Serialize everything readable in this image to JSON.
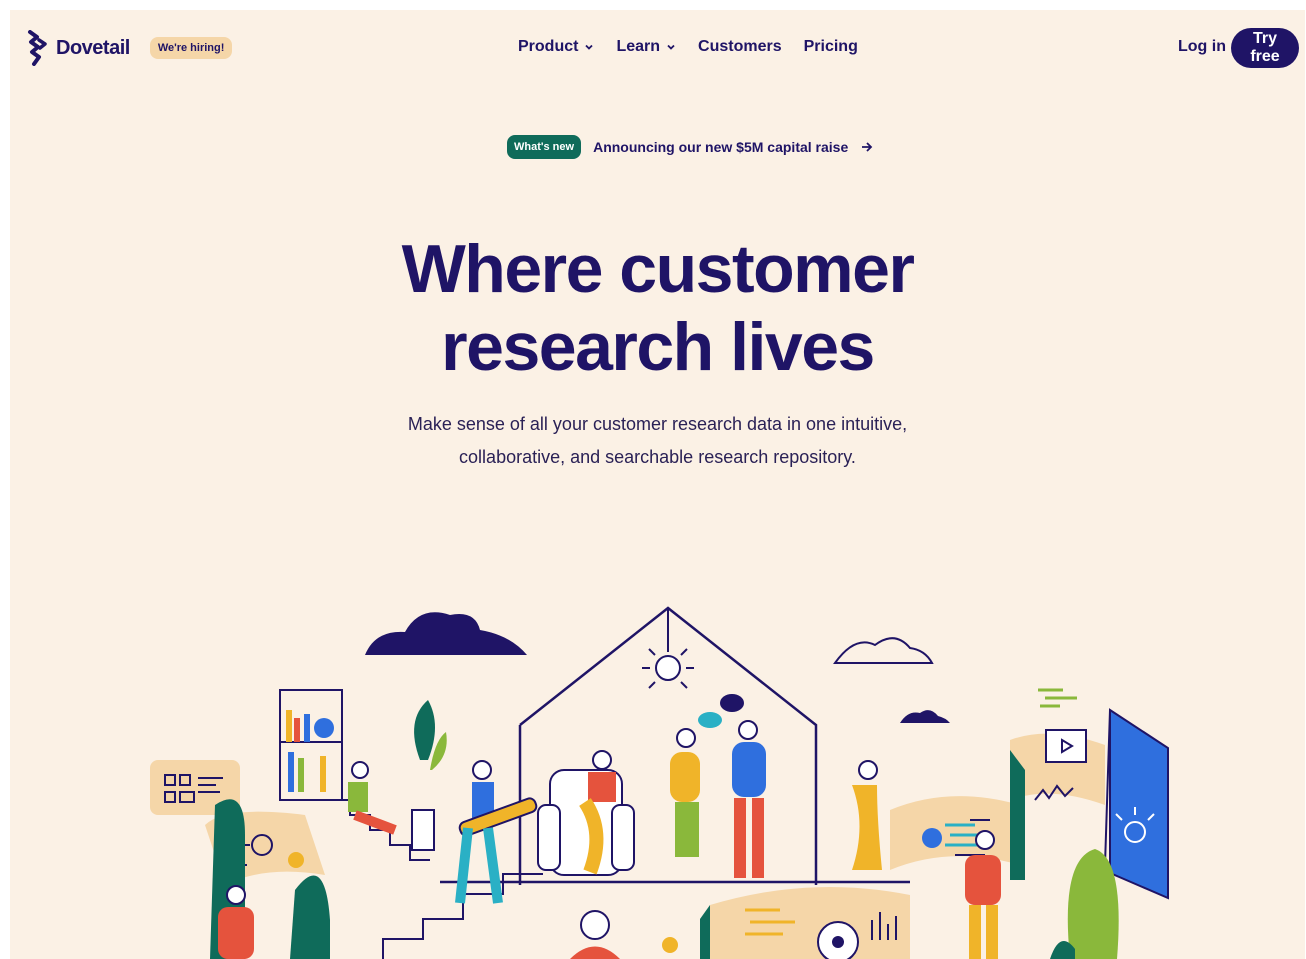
{
  "nav": {
    "brand": "Dovetail",
    "hiring_badge": "We're hiring!",
    "links": [
      {
        "label": "Product",
        "has_dropdown": true
      },
      {
        "label": "Learn",
        "has_dropdown": true
      },
      {
        "label": "Customers",
        "has_dropdown": false
      },
      {
        "label": "Pricing",
        "has_dropdown": false
      }
    ],
    "login_label": "Log in",
    "cta_label": "Try free"
  },
  "announcement": {
    "badge": "What's new",
    "text": "Announcing our new $5M capital raise"
  },
  "hero": {
    "headline_line1": "Where customer",
    "headline_line2": "research lives",
    "subtitle_line1": "Make sense of all your customer research data in one intuitive,",
    "subtitle_line2": "collaborative, and searchable research repository."
  },
  "colors": {
    "brand": "#1f1466",
    "background": "#fbf1e5",
    "whats_new": "#0f6b5a",
    "hiring_badge": "#f5d6a8"
  },
  "icons": [
    "dovetail-logo-icon",
    "chevron-down-icon",
    "arrow-right-icon"
  ]
}
